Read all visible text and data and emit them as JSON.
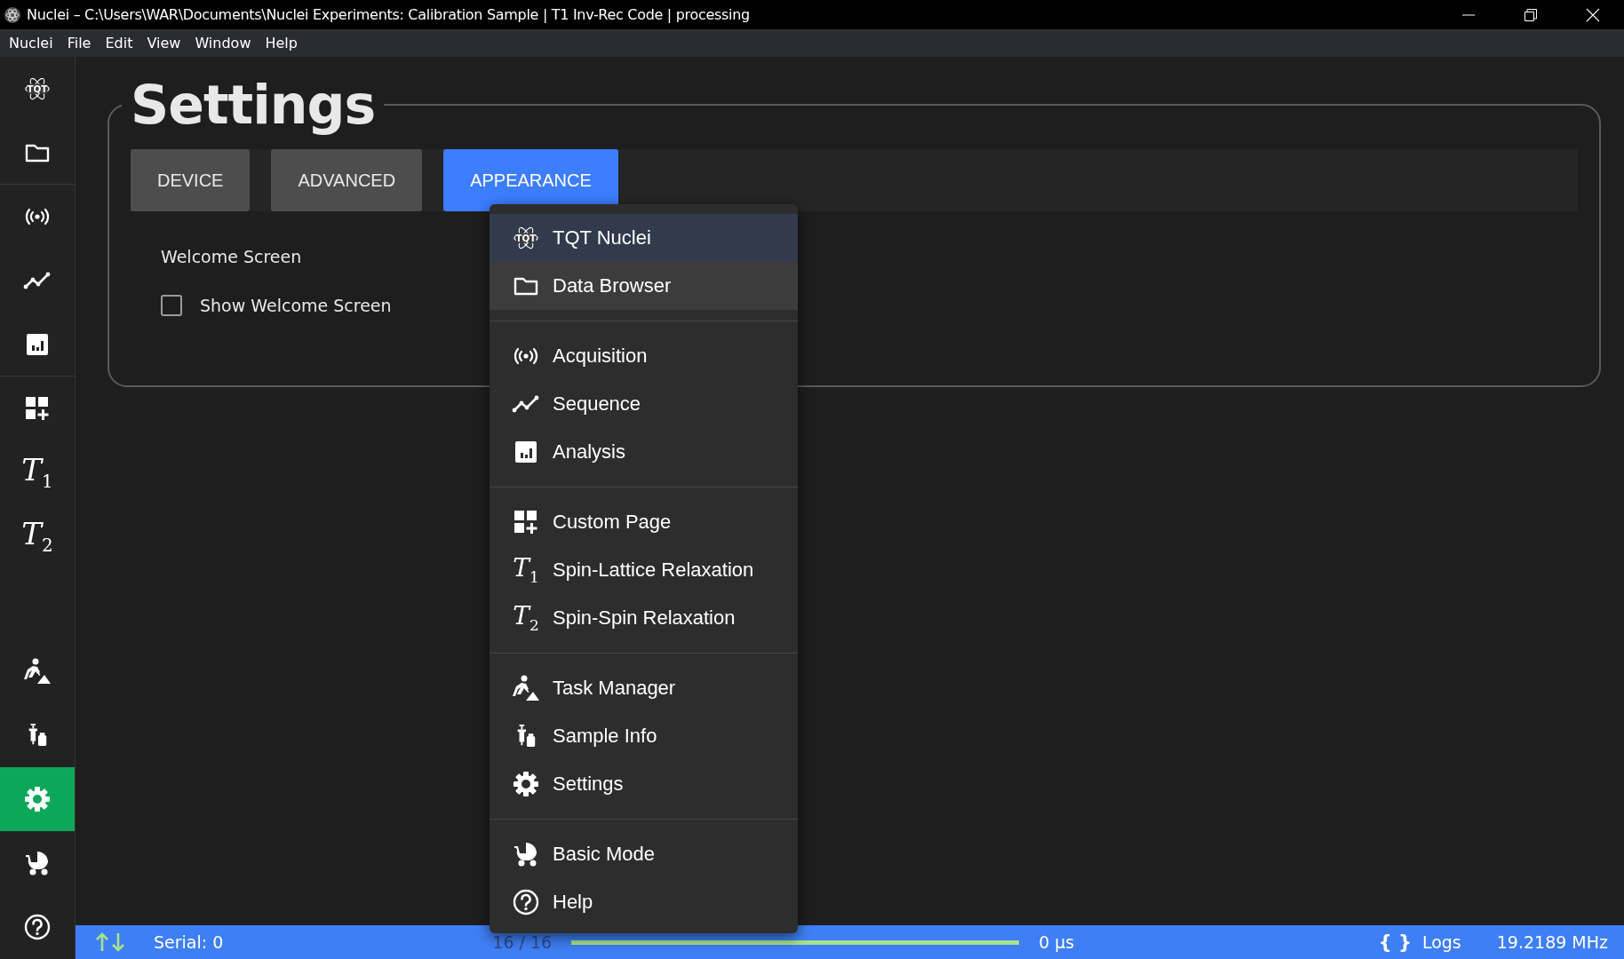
{
  "window": {
    "title": "Nuclei – C:\\Users\\WAR\\Documents\\Nuclei Experiments: Calibration Sample | T1 Inv-Rec Code | processing"
  },
  "menu_bar": [
    "Nuclei",
    "File",
    "Edit",
    "View",
    "Window",
    "Help"
  ],
  "sidebar": {
    "top_items": [
      {
        "kind": "logo",
        "icon_text": "TQT",
        "selected": false,
        "divider_after": false
      },
      {
        "kind": "folder",
        "selected": false,
        "divider_after": true
      },
      {
        "kind": "broadcast",
        "selected": false,
        "divider_after": false
      },
      {
        "kind": "sequence",
        "selected": false,
        "divider_after": false
      },
      {
        "kind": "analysis",
        "selected": false,
        "divider_after": true
      },
      {
        "kind": "custom",
        "selected": false,
        "divider_after": false
      },
      {
        "kind": "tsub",
        "icon_text": "T$_{1}$",
        "selected": false,
        "divider_after": false
      },
      {
        "kind": "tsub",
        "icon_text": "T$_{2}$",
        "selected": false,
        "divider_after": false
      }
    ],
    "bottom_items": [
      {
        "kind": "task",
        "selected": false,
        "divider_after": false
      },
      {
        "kind": "sample",
        "selected": false,
        "divider_after": false
      },
      {
        "kind": "gear",
        "selected": true,
        "divider_after": false
      },
      {
        "kind": "stroller",
        "selected": false,
        "divider_after": false
      },
      {
        "kind": "help",
        "selected": false,
        "divider_after": false
      }
    ]
  },
  "settings": {
    "title": "Settings",
    "tabs": [
      {
        "label": "DEVICE",
        "selected": false
      },
      {
        "label": "ADVANCED",
        "selected": false
      },
      {
        "label": "APPEARANCE",
        "selected": true
      }
    ],
    "section": "Welcome Screen",
    "checkbox": {
      "label": "Show Welcome Screen",
      "checked": false
    }
  },
  "dropdown_menu": {
    "sections": [
      [
        {
          "kind": "logo",
          "icon_text": "TQT",
          "label": "TQT Nuclei",
          "selected": true,
          "hovered": false
        },
        {
          "kind": "folder",
          "label": "Data Browser",
          "selected": false,
          "hovered": true
        }
      ],
      [
        {
          "kind": "broadcast",
          "label": "Acquisition",
          "selected": false,
          "hovered": false
        },
        {
          "kind": "sequence",
          "label": "Sequence",
          "selected": false,
          "hovered": false
        },
        {
          "kind": "analysis",
          "label": "Analysis",
          "selected": false,
          "hovered": false
        }
      ],
      [
        {
          "kind": "custom",
          "label": "Custom Page",
          "selected": false,
          "hovered": false
        },
        {
          "kind": "tsub",
          "icon_text": "T$_{1}$",
          "label": "Spin-Lattice Relaxation",
          "selected": false,
          "hovered": false
        },
        {
          "kind": "tsub",
          "icon_text": "T$_{2}$",
          "label": "Spin-Spin Relaxation",
          "selected": false,
          "hovered": false
        }
      ],
      [
        {
          "kind": "task",
          "label": "Task Manager",
          "selected": false,
          "hovered": false
        },
        {
          "kind": "sample",
          "label": "Sample Info",
          "selected": false,
          "hovered": false
        },
        {
          "kind": "gear",
          "label": "Settings",
          "selected": false,
          "hovered": false
        }
      ],
      [
        {
          "kind": "stroller",
          "label": "Basic Mode",
          "selected": false,
          "hovered": false
        },
        {
          "kind": "help",
          "label": "Help",
          "selected": false,
          "hovered": false
        }
      ]
    ]
  },
  "status_bar": {
    "serial": "Serial: 0",
    "count": "16 / 16",
    "progress": {
      "level": 1.0
    },
    "time": "0 µs",
    "logs_glyph": "{ }",
    "logs": "Logs",
    "frequency": "19.2189 MHz"
  }
}
